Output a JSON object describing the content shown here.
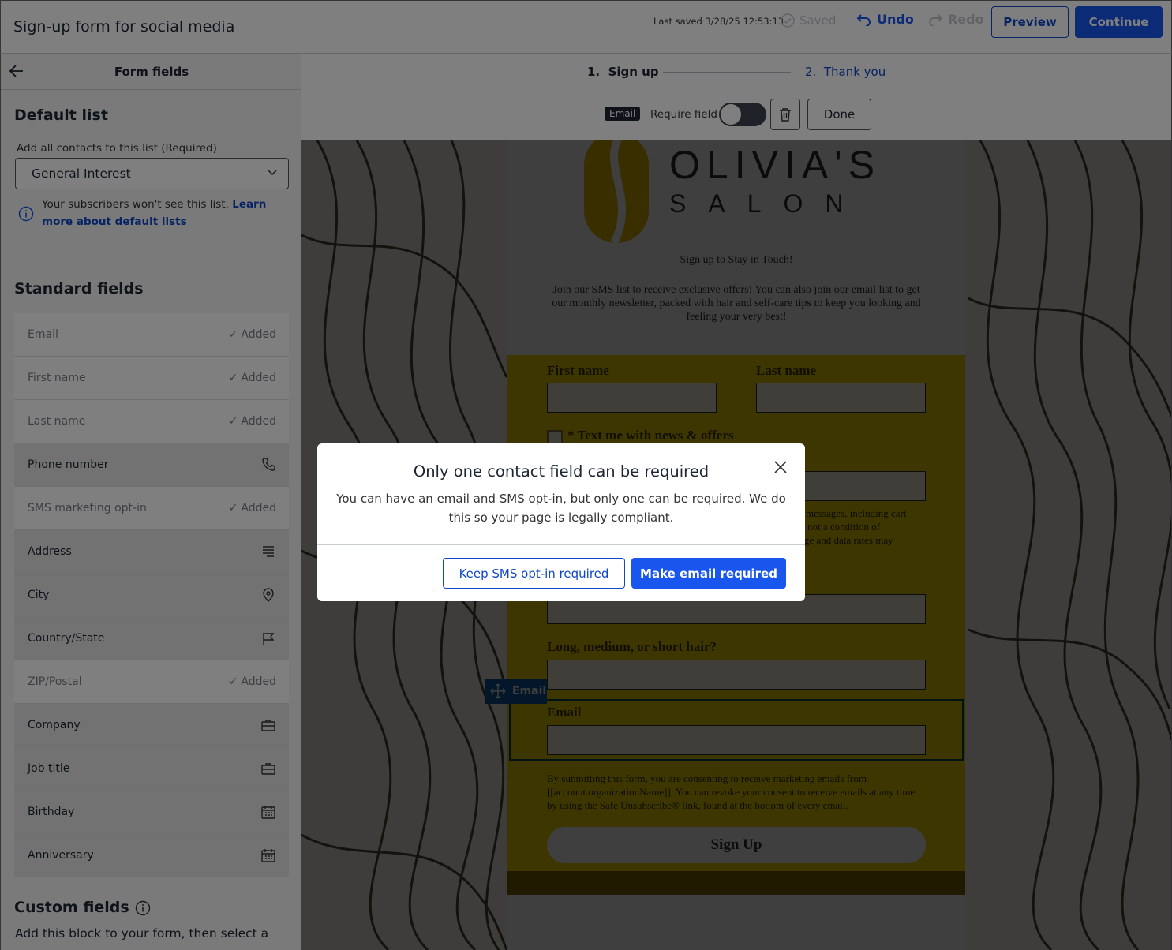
{
  "header": {
    "title": "Sign-up form for social media",
    "last_saved": "Last saved 3/28/25 12:53:13",
    "saved_label": "Saved",
    "undo_label": "Undo",
    "redo_label": "Redo",
    "preview_label": "Preview",
    "continue_label": "Continue"
  },
  "sidebar": {
    "title": "Form fields",
    "default_list": {
      "title": "Default list",
      "label": "Add all contacts to this list  (Required)",
      "selected": "General Interest",
      "info_text": "Your subscribers won't see this list.",
      "info_link": "Learn more about default lists"
    },
    "standard_fields": {
      "title": "Standard fields",
      "items": [
        {
          "label": "Email",
          "status": "Added"
        },
        {
          "label": "First name",
          "status": "Added"
        },
        {
          "label": "Last name",
          "status": "Added"
        },
        {
          "label": "Phone number",
          "icon": "phone-icon"
        },
        {
          "label": "SMS marketing opt-in",
          "status": "Added"
        },
        {
          "label": "Address",
          "icon": "address-icon"
        },
        {
          "label": "City",
          "icon": "location-pin-icon"
        },
        {
          "label": "Country/State",
          "icon": "flag-icon"
        },
        {
          "label": "ZIP/Postal",
          "status": "Added"
        },
        {
          "label": "Company",
          "icon": "briefcase-icon"
        },
        {
          "label": "Job title",
          "icon": "briefcase-icon"
        },
        {
          "label": "Birthday",
          "icon": "calendar-icon"
        },
        {
          "label": "Anniversary",
          "icon": "calendar-icon"
        }
      ]
    },
    "custom_fields": {
      "title": "Custom fields",
      "description": "Add this block to your form, then select a"
    }
  },
  "editor": {
    "steps": [
      {
        "number": "1.",
        "label": "Sign up"
      },
      {
        "number": "2.",
        "label": "Thank you"
      }
    ],
    "field_tag": "Email",
    "require_field_label": "Require field",
    "require_field_on": false,
    "done_label": "Done"
  },
  "form": {
    "logo_name": "OLIVIA'S",
    "logo_sub": "SALON",
    "heading": "Sign up to Stay in Touch!",
    "intro": "Join our SMS list to receive exclusive offers! You can also join our email list to get our monthly newsletter, packed with hair and self-care tips to keep you looking and feeling your very best!",
    "first_name_label": "First name",
    "last_name_label": "Last name",
    "sms_label": "* Text me with news & offers",
    "sms_disclaimer_1": "messages, including cart",
    "sms_disclaimer_2": "not a condition of",
    "sms_disclaimer_3": "ge and data rates may",
    "hair_label": "Long, medium, or short hair?",
    "email_handle": "Email",
    "email_label": "Email",
    "consent": "By submitting this form, you are consenting to receive marketing emails from [[account.organizationName]]. You can revoke your consent to receive emails at any time by using the Safe Unsubscribe® link, found at the bottom of every email.",
    "signup_label": "Sign Up"
  },
  "modal": {
    "title": "Only one contact field can be required",
    "body": "You can have an email and SMS opt-in, but only one can be required. We do this so your page is legally compliant.",
    "secondary_label": "Keep SMS opt-in required",
    "primary_label": "Make email required"
  },
  "colors": {
    "accent": "#1856ed",
    "accent_dark": "#0f47c7",
    "form_yellow": "#f9d806",
    "email_handle": "#0d5ba8"
  }
}
